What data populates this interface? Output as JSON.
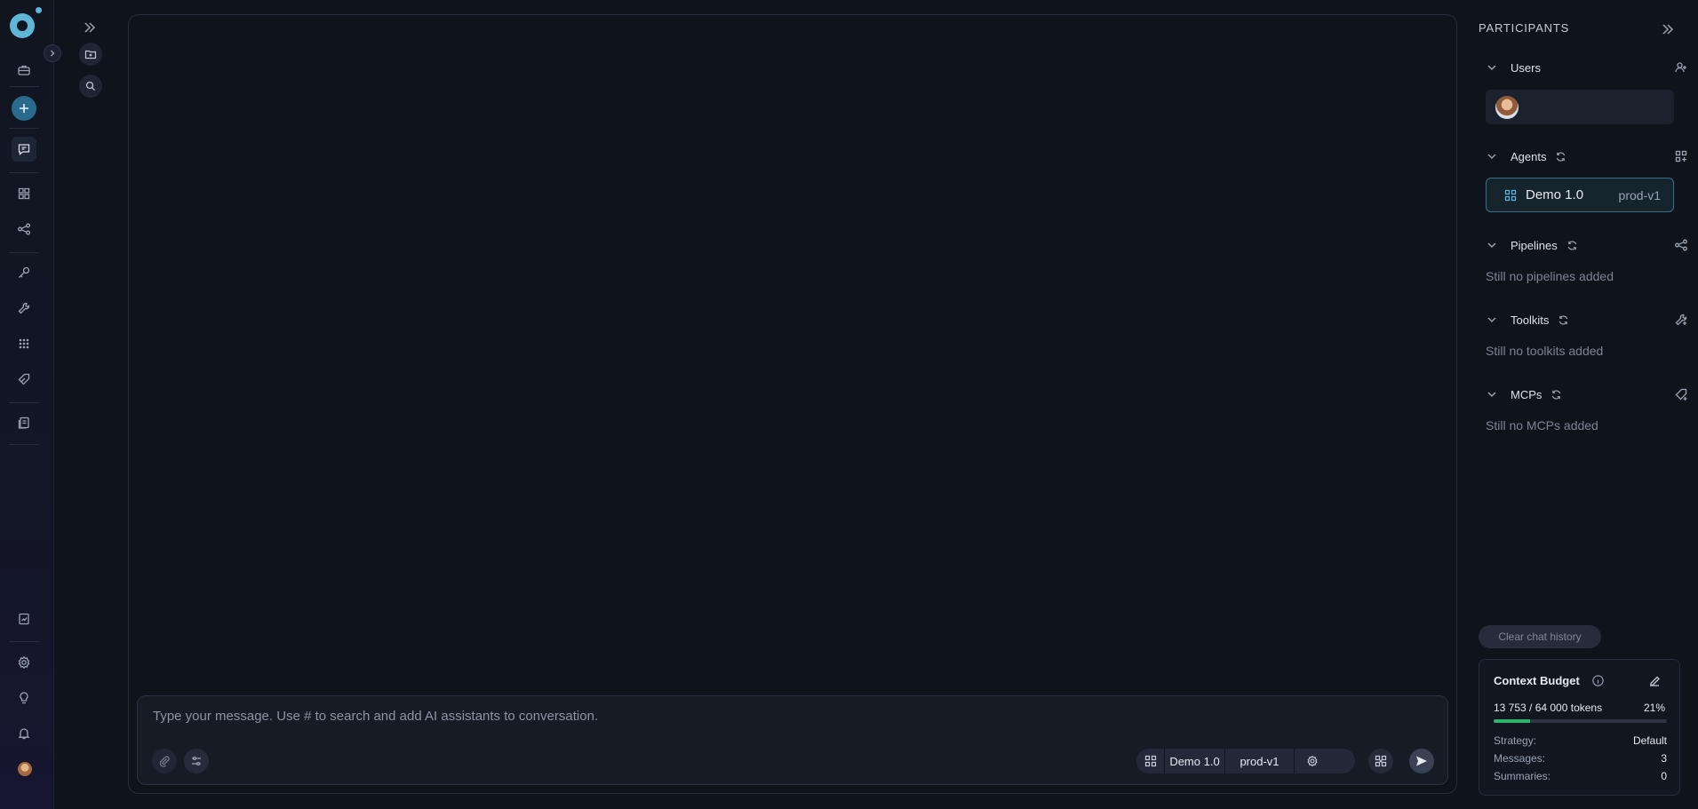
{
  "colors": {
    "background": "#0f131c",
    "accent": "#5fb6d6",
    "progress": "#2fb36b",
    "agent_border": "#3c6f85"
  },
  "left_rail": {
    "icons": [
      "app-logo-icon",
      "briefcase-icon",
      "plus-icon",
      "chat-icon",
      "apps-grid-icon",
      "pipelines-icon",
      "key-icon",
      "wrench-icon",
      "dots-grid-icon",
      "tag-icon",
      "documents-icon",
      "report-icon",
      "settings-icon",
      "lightbulb-icon",
      "bell-icon",
      "user-avatar-icon"
    ]
  },
  "composer": {
    "placeholder": "Type your message. Use # to search and add AI assistants to conversation.",
    "agent_name": "Demo 1.0",
    "agent_version": "prod-v1"
  },
  "participants": {
    "title": "PARTICIPANTS",
    "sections": {
      "users": {
        "label": "Users"
      },
      "agents": {
        "label": "Agents",
        "items": [
          {
            "name": "Demo 1.0",
            "version": "prod-v1"
          }
        ]
      },
      "pipelines": {
        "label": "Pipelines",
        "empty": "Still no pipelines added"
      },
      "toolkits": {
        "label": "Toolkits",
        "empty": "Still no toolkits added"
      },
      "mcps": {
        "label": "MCPs",
        "empty": "Still no MCPs added"
      }
    }
  },
  "clear_history_label": "Clear chat history",
  "context_budget": {
    "title": "Context Budget",
    "tokens": "13 753 / 64 000 tokens",
    "percent_label": "21%",
    "percent": 0.21,
    "strategy_label": "Strategy:",
    "strategy_value": "Default",
    "messages_label": "Messages:",
    "messages_value": "3",
    "summaries_label": "Summaries:",
    "summaries_value": "0"
  }
}
